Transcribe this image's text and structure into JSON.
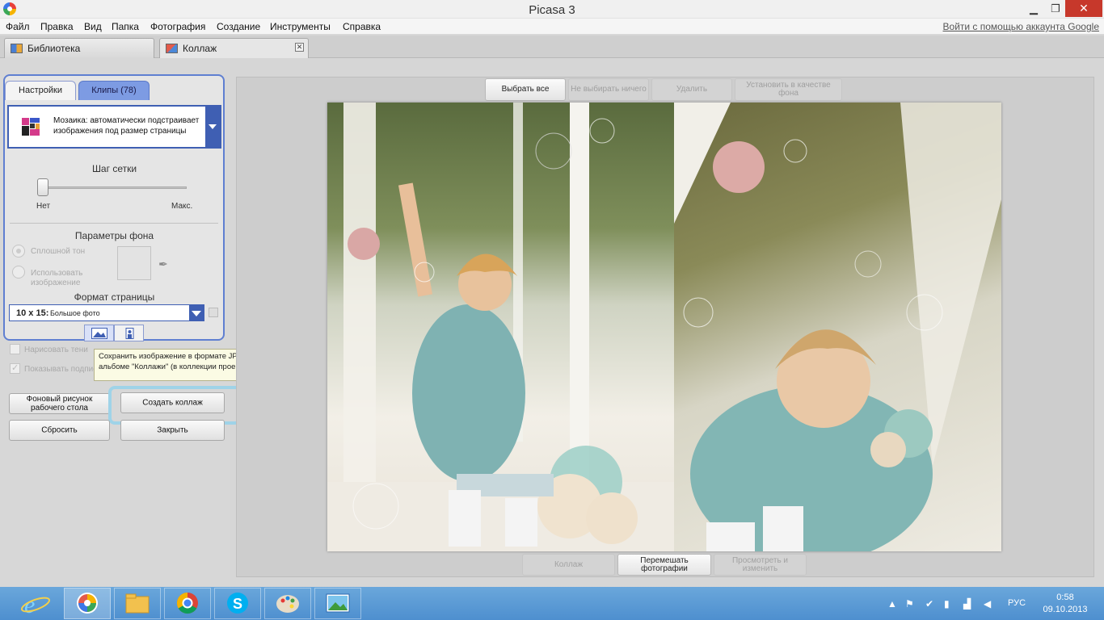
{
  "window": {
    "title": "Picasa 3"
  },
  "menu": {
    "items": [
      "Файл",
      "Правка",
      "Вид",
      "Папка",
      "Фотография",
      "Создание",
      "Инструменты",
      "Справка"
    ],
    "login": "Войти с помощью аккаунта Google"
  },
  "tabs": [
    {
      "label": "Библиотека"
    },
    {
      "label": "Коллаж"
    }
  ],
  "panel": {
    "tab_settings": "Настройки",
    "tab_clips": "Клипы (78)",
    "layout_text": "Мозаика: автоматически подстраивает изображения под размер страницы",
    "grid_title": "Шаг сетки",
    "grid_min": "Нет",
    "grid_max": "Макс.",
    "grid_value": 0,
    "bg_title": "Параметры фона",
    "bg_solid": "Сплошной тон",
    "bg_image": "Использовать изображение",
    "format_title": "Формат страницы",
    "format_bold": "10 x 15:",
    "format_rest": "Большое фото",
    "shadow_label": "Нарисовать тени",
    "caption_label": "Показывать подписи",
    "tooltip": "Сохранить изображение в формате JPG в альбоме \"Коллажи\" (в коллекции проектов).",
    "btn_wallpaper": "Фоновый рисунок рабочего стола",
    "btn_create": "Создать коллаж",
    "btn_reset": "Сбросить",
    "btn_close": "Закрыть"
  },
  "toolbar": {
    "select_all": "Выбрать все",
    "select_none": "Не выбирать ничего",
    "delete": "Удалить",
    "set_bg": "Установить в качестве фона"
  },
  "bottom": {
    "collage": "Коллаж",
    "shuffle": "Перемешать фотографии",
    "view_edit": "Просмотреть и изменить"
  },
  "tray": {
    "lang": "РУС",
    "time": "0:58",
    "date": "09.10.2013"
  },
  "colors": {
    "panel_accent": "#5f7fd1",
    "highlight": "#9fd3e8",
    "taskbar": "#5b9bd5",
    "close_btn": "#c7382b"
  }
}
